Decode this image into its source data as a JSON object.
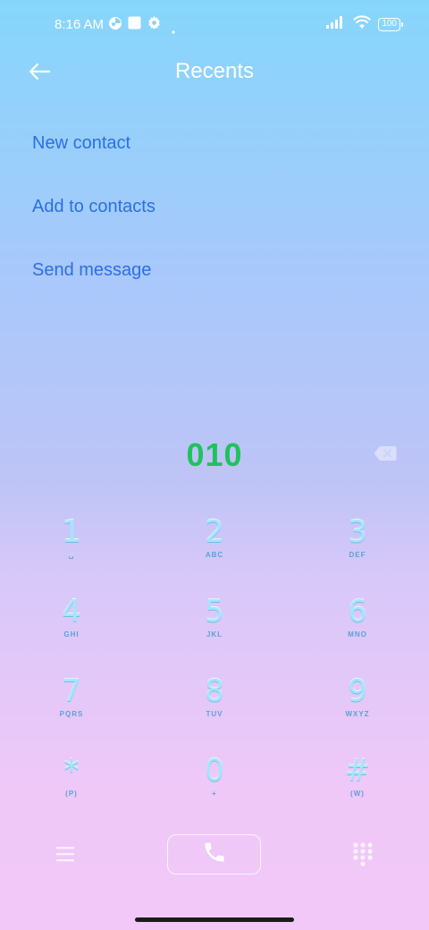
{
  "status_bar": {
    "time": "8:16 AM",
    "icons": [
      "app-icon",
      "square-icon",
      "gear-icon",
      "dot-icon",
      "signal-icon",
      "wifi-icon"
    ],
    "battery": "100"
  },
  "header": {
    "title": "Recents",
    "back_icon": "back-arrow-icon"
  },
  "actions": [
    {
      "label": "New contact"
    },
    {
      "label": "Add to contacts"
    },
    {
      "label": "Send message"
    }
  ],
  "dialer": {
    "number": "010",
    "number_color": "#1fc25b",
    "backspace_icon": "backspace-icon"
  },
  "keypad": [
    {
      "digit": "1",
      "letters": "␣"
    },
    {
      "digit": "2",
      "letters": "ABC"
    },
    {
      "digit": "3",
      "letters": "DEF"
    },
    {
      "digit": "4",
      "letters": "GHI"
    },
    {
      "digit": "5",
      "letters": "JKL"
    },
    {
      "digit": "6",
      "letters": "MNO"
    },
    {
      "digit": "7",
      "letters": "PQRS"
    },
    {
      "digit": "8",
      "letters": "TUV"
    },
    {
      "digit": "9",
      "letters": "WXYZ"
    },
    {
      "digit": "*",
      "letters": "(P)"
    },
    {
      "digit": "0",
      "letters": "+"
    },
    {
      "digit": "#",
      "letters": "(W)"
    }
  ],
  "bottom_bar": {
    "menu_icon": "menu-icon",
    "call_icon": "phone-icon",
    "dialpad_icon": "dialpad-icon"
  },
  "colors": {
    "accent": "#2d6fe3",
    "title": "#ffffff"
  }
}
